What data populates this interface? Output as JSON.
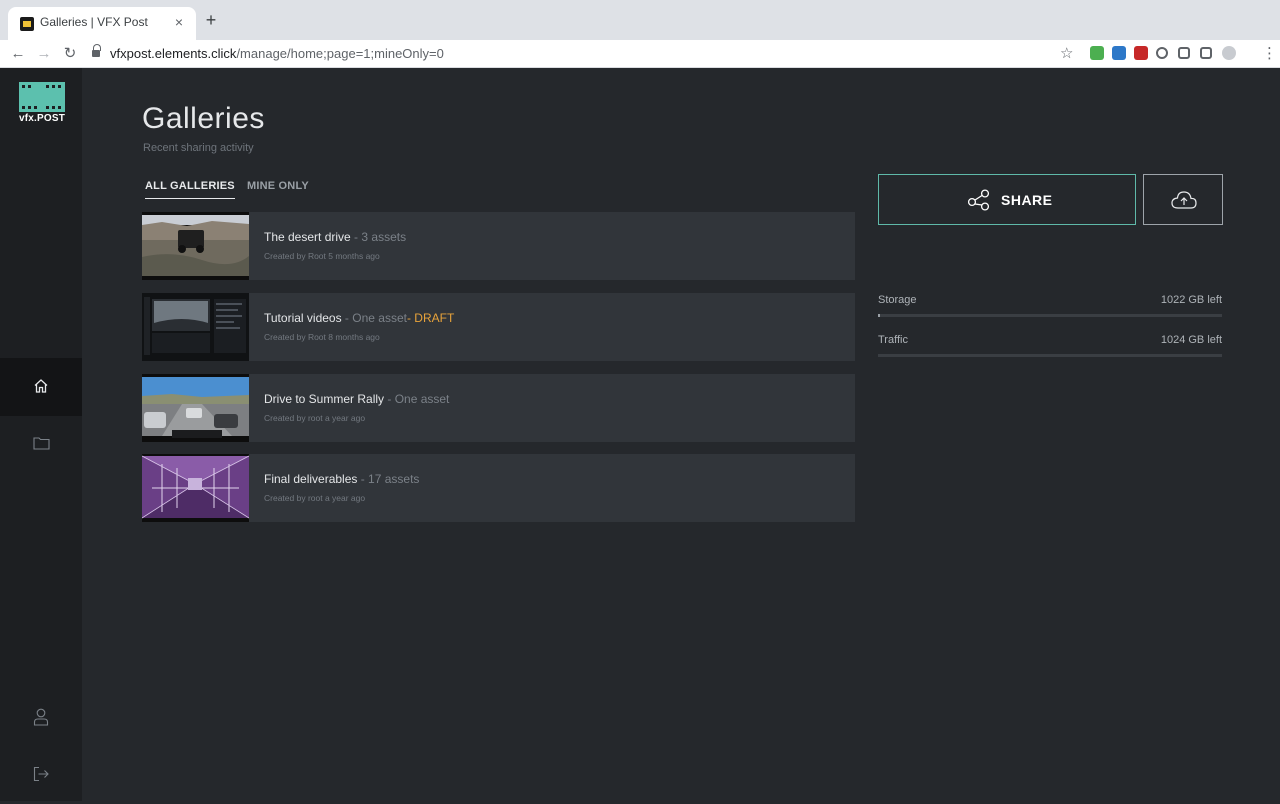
{
  "browser": {
    "tab_title": "Galleries | VFX Post",
    "tab_close": "×",
    "new_tab": "+",
    "url_host": "vfxpost.elements.click",
    "url_path": "/manage/home;page=1;mineOnly=0",
    "extensions": [
      {
        "icon": "shield-extension-icon",
        "color": "#4caf50"
      },
      {
        "icon": "dashlane-extension-icon",
        "color": "#2d78c8"
      },
      {
        "icon": "pen-extension-icon",
        "color": "#c62828"
      },
      {
        "icon": "circle-extension-icon",
        "color": "#5f6368"
      },
      {
        "icon": "pill-extension-icon",
        "color": "#5f6368"
      },
      {
        "icon": "puzzle-extension-icon",
        "color": "#5f6368"
      },
      {
        "icon": "profile-avatar-icon",
        "color": "#c8cbd0"
      }
    ]
  },
  "app": {
    "logo_text": "vfx.POST",
    "accent": "#5fb9a9",
    "sidebar": [
      {
        "icon": "home-icon",
        "active": true
      },
      {
        "icon": "folder-icon",
        "active": false
      },
      {
        "icon": "user-icon",
        "active": false
      },
      {
        "icon": "logout-icon",
        "active": false
      }
    ]
  },
  "page": {
    "title": "Galleries",
    "subtitle": "Recent sharing activity"
  },
  "tabs": [
    {
      "label": "ALL GALLERIES",
      "active": true
    },
    {
      "label": "MINE ONLY",
      "active": false
    }
  ],
  "galleries": [
    {
      "name": "The desert drive",
      "meta": " - 3 assets",
      "draft": "",
      "created": "Created by Root  5 months ago"
    },
    {
      "name": "Tutorial videos",
      "meta": " - One asset",
      "draft": "- DRAFT",
      "created": "Created by Root  8 months ago"
    },
    {
      "name": "Drive to Summer Rally",
      "meta": " - One asset",
      "draft": "",
      "created": "Created by root  a year ago"
    },
    {
      "name": "Final deliverables",
      "meta": " - 17 assets",
      "draft": "",
      "created": "Created by root  a year ago"
    }
  ],
  "actions": {
    "share_label": "SHARE"
  },
  "quota": {
    "storage": {
      "label": "Storage",
      "value": "1022 GB left",
      "used_fraction": 0.002
    },
    "traffic": {
      "label": "Traffic",
      "value": "1024 GB left",
      "used_fraction": 0.0
    }
  }
}
